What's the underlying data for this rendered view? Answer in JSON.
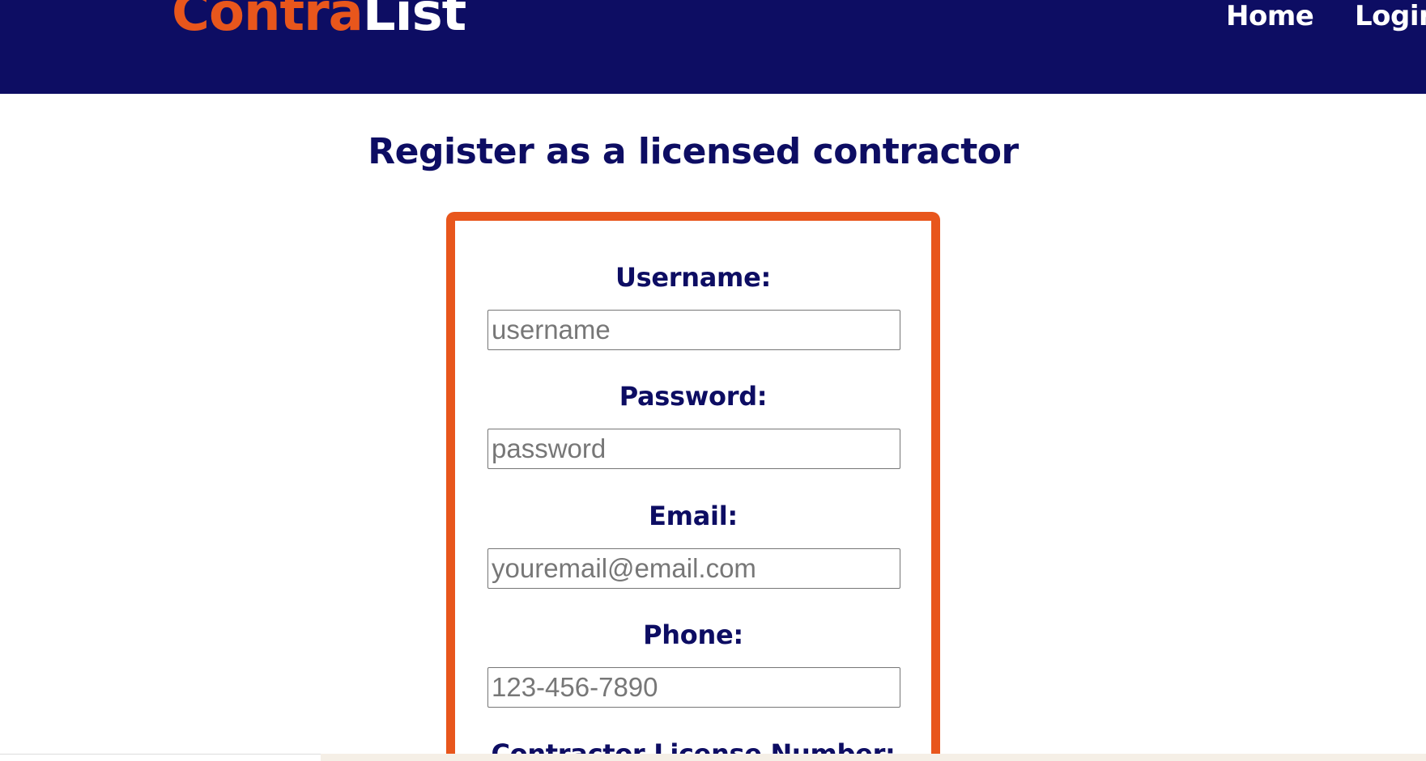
{
  "header": {
    "logo_part1": "Contra",
    "logo_part2": "List",
    "nav": {
      "home": "Home",
      "login": "Login"
    }
  },
  "main": {
    "title": "Register as a licensed contractor",
    "form": {
      "fields": [
        {
          "label": "Username:",
          "placeholder": "username",
          "value": ""
        },
        {
          "label": "Password:",
          "placeholder": "password",
          "value": ""
        },
        {
          "label": "Email:",
          "placeholder": "youremail@email.com",
          "value": ""
        },
        {
          "label": "Phone:",
          "placeholder": "123-456-7890",
          "value": ""
        },
        {
          "label": "Contractor License Number:"
        }
      ]
    }
  },
  "colors": {
    "navy": "#0d0d63",
    "orange": "#e8561c"
  }
}
